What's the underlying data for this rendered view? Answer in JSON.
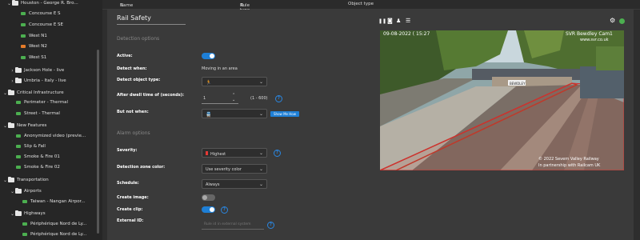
{
  "sidebar": {
    "items": [
      {
        "label": "Houston - George R. Bro...",
        "kind": "folder",
        "top": 0
      },
      {
        "label": "Concourse E S",
        "kind": "cam",
        "color": "#4caf50"
      },
      {
        "label": "Concourse E SE",
        "kind": "cam",
        "color": "#4caf50"
      },
      {
        "label": "West N1",
        "kind": "cam",
        "color": "#4caf50"
      },
      {
        "label": "West N2",
        "kind": "cam",
        "color": "#e57c2a"
      },
      {
        "label": "West S1",
        "kind": "cam",
        "color": "#4caf50"
      },
      {
        "label": "Jackson Hole - live",
        "kind": "folder"
      },
      {
        "label": "Umbria - Italy - live",
        "kind": "folder"
      },
      {
        "label": "Critical Infrastructure",
        "kind": "folder"
      },
      {
        "label": "Perimeter - Thermal",
        "kind": "cam",
        "color": "#4caf50"
      },
      {
        "label": "Street - Thermal",
        "kind": "cam",
        "color": "#4caf50"
      },
      {
        "label": "New Features",
        "kind": "folder"
      },
      {
        "label": "Anonymized video (previe...",
        "kind": "cam",
        "color": "#4caf50"
      },
      {
        "label": "Slip & Fall",
        "kind": "cam",
        "color": "#4caf50"
      },
      {
        "label": "Smoke & Fire 01",
        "kind": "cam",
        "color": "#4caf50"
      },
      {
        "label": "Smoke & Fire 02",
        "kind": "cam",
        "color": "#4caf50"
      },
      {
        "label": "Transportation",
        "kind": "folder"
      },
      {
        "label": "Airports",
        "kind": "folder"
      },
      {
        "label": "Taiwan - Nangan Airpor...",
        "kind": "cam",
        "color": "#4caf50"
      },
      {
        "label": "Highways",
        "kind": "folder"
      },
      {
        "label": "Périphérique Nord de Ly...",
        "kind": "cam",
        "color": "#4caf50"
      },
      {
        "label": "Périphérique Nord de Ly...",
        "kind": "cam",
        "color": "#4caf50"
      }
    ]
  },
  "header": {
    "name": "Name",
    "rule_type": "Rule type",
    "object_type": "Object type",
    "sort_icon": "sort-icon"
  },
  "rule": {
    "title": "Rail Safety",
    "detection_section": "Detection options",
    "active_label": "Active:",
    "detect_when_label": "Detect when:",
    "detect_when_value": "Moving in an area",
    "detect_object_label": "Detect object type:",
    "dwell_label": "After dwell time of (seconds):",
    "dwell_value": "1",
    "dwell_range": "(1 - 600)",
    "but_not_label": "But not when:",
    "show_me_how": "Show Me How",
    "alarm_section": "Alarm options",
    "severity_label": "Severity:",
    "severity_value": "Highest",
    "zone_color_label": "Detection zone color:",
    "zone_color_value": "Use severity color",
    "schedule_label": "Schedule:",
    "schedule_value": "Always",
    "create_image_label": "Create image:",
    "create_clip_label": "Create clip:",
    "external_id_label": "External ID:",
    "external_id_placeholder": "Rule id in external system"
  },
  "camera": {
    "timestamp": "09-08-2022 ( 15:27",
    "overlay_title": "SVR Bewdley Cam1",
    "overlay_url": "www.svr.co.uk",
    "station_sign": "BEWDLEY",
    "footer_1": "© 2022 Severn Valley Railway",
    "footer_2": "In partnership with Railcam UK",
    "icons": [
      "pause-icon",
      "camera-icon",
      "person-icon",
      "list-icon"
    ],
    "status_color": "#4caf50"
  },
  "colors": {
    "accent": "#1e7fd6",
    "severity": "#e53935"
  }
}
